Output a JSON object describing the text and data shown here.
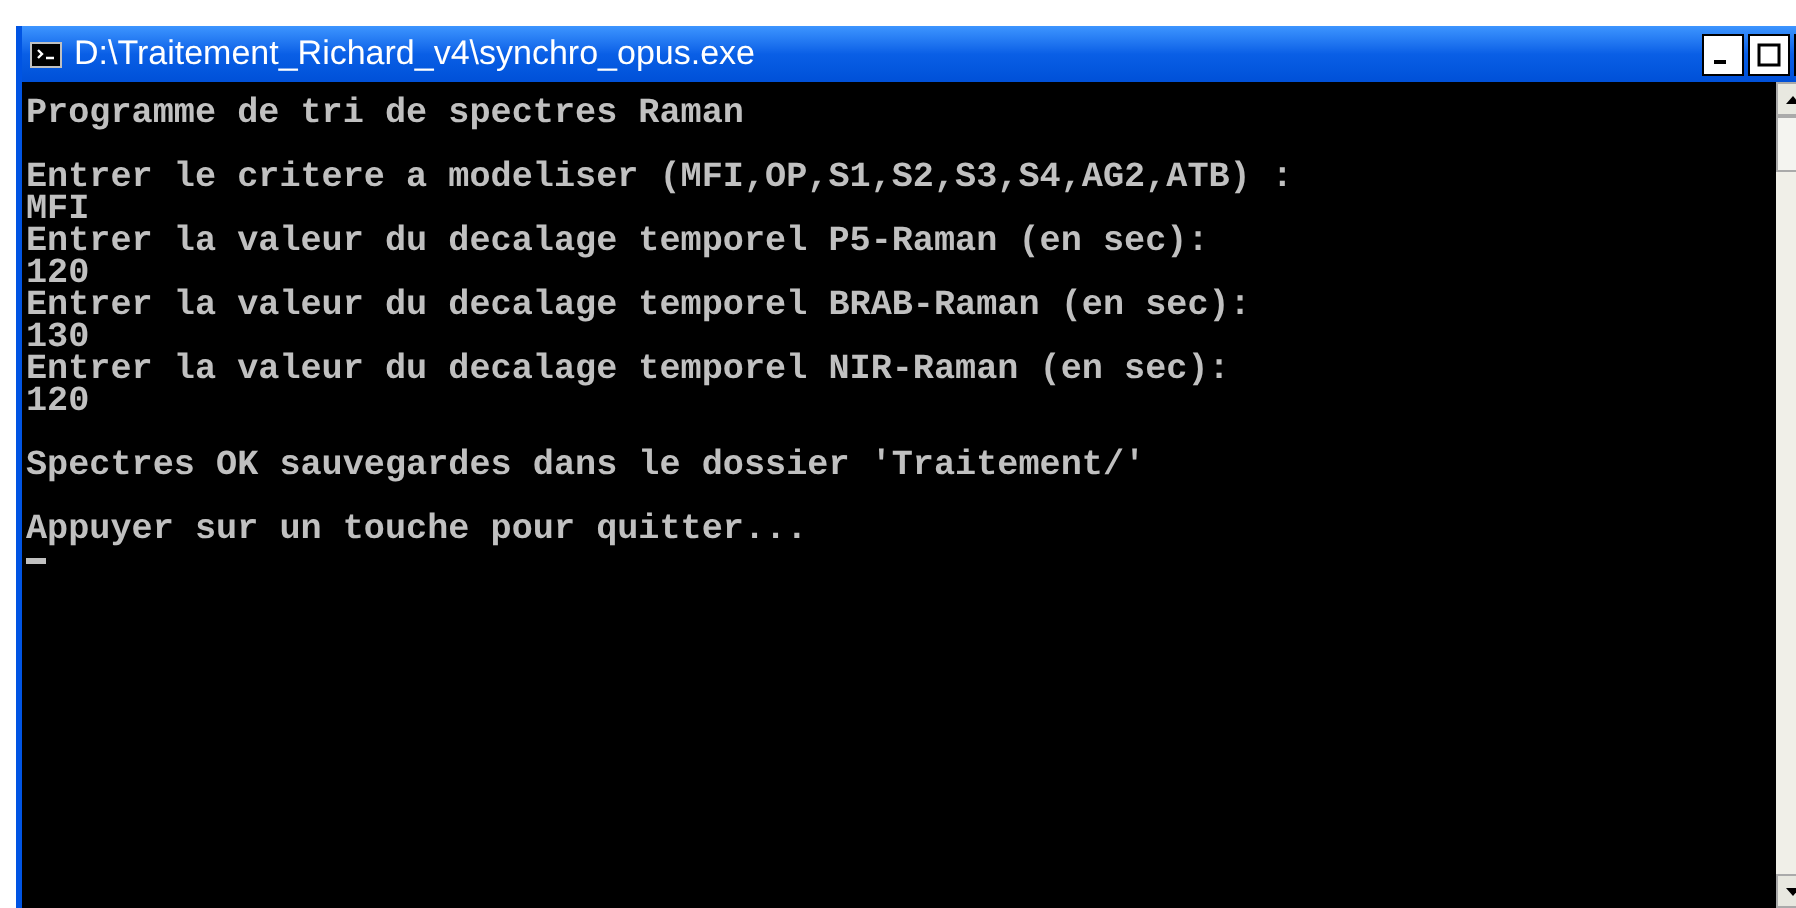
{
  "window": {
    "title": "D:\\Traitement_Richard_v4\\synchro_opus.exe"
  },
  "console": {
    "blocks": [
      [
        "Programme de tri de spectres Raman"
      ],
      [
        "Entrer le critere a modeliser (MFI,OP,S1,S2,S3,S4,AG2,ATB) :",
        "MFI",
        "Entrer la valeur du decalage temporel P5-Raman (en sec):",
        "120",
        "Entrer la valeur du decalage temporel BRAB-Raman (en sec):",
        "130",
        "Entrer la valeur du decalage temporel NIR-Raman (en sec):",
        "120"
      ],
      [
        "Spectres OK sauvegardes dans le dossier 'Traitement/'"
      ],
      [
        "Appuyer sur un touche pour quitter..."
      ]
    ]
  }
}
